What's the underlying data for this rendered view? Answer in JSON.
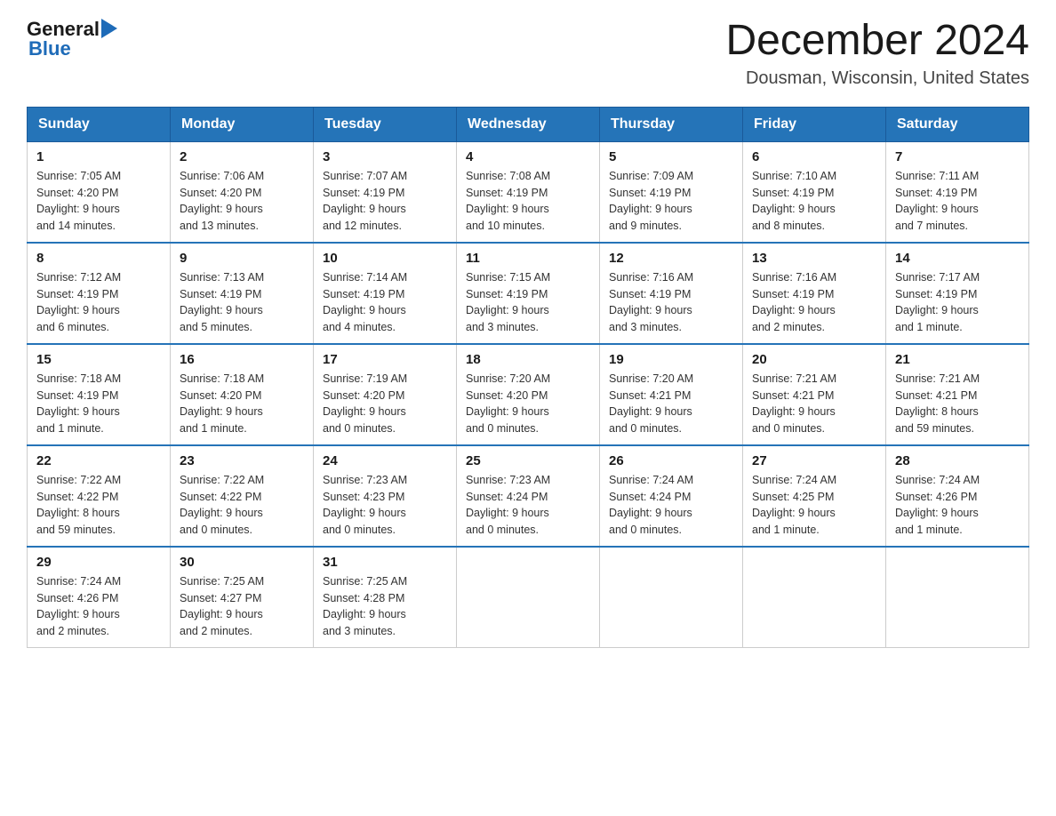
{
  "header": {
    "logo": {
      "general": "General",
      "blue": "Blue",
      "arrow": "▶"
    },
    "title": "December 2024",
    "location": "Dousman, Wisconsin, United States"
  },
  "days_of_week": [
    "Sunday",
    "Monday",
    "Tuesday",
    "Wednesday",
    "Thursday",
    "Friday",
    "Saturday"
  ],
  "weeks": [
    [
      {
        "day": "1",
        "sunrise": "7:05 AM",
        "sunset": "4:20 PM",
        "daylight": "9 hours and 14 minutes."
      },
      {
        "day": "2",
        "sunrise": "7:06 AM",
        "sunset": "4:20 PM",
        "daylight": "9 hours and 13 minutes."
      },
      {
        "day": "3",
        "sunrise": "7:07 AM",
        "sunset": "4:19 PM",
        "daylight": "9 hours and 12 minutes."
      },
      {
        "day": "4",
        "sunrise": "7:08 AM",
        "sunset": "4:19 PM",
        "daylight": "9 hours and 10 minutes."
      },
      {
        "day": "5",
        "sunrise": "7:09 AM",
        "sunset": "4:19 PM",
        "daylight": "9 hours and 9 minutes."
      },
      {
        "day": "6",
        "sunrise": "7:10 AM",
        "sunset": "4:19 PM",
        "daylight": "9 hours and 8 minutes."
      },
      {
        "day": "7",
        "sunrise": "7:11 AM",
        "sunset": "4:19 PM",
        "daylight": "9 hours and 7 minutes."
      }
    ],
    [
      {
        "day": "8",
        "sunrise": "7:12 AM",
        "sunset": "4:19 PM",
        "daylight": "9 hours and 6 minutes."
      },
      {
        "day": "9",
        "sunrise": "7:13 AM",
        "sunset": "4:19 PM",
        "daylight": "9 hours and 5 minutes."
      },
      {
        "day": "10",
        "sunrise": "7:14 AM",
        "sunset": "4:19 PM",
        "daylight": "9 hours and 4 minutes."
      },
      {
        "day": "11",
        "sunrise": "7:15 AM",
        "sunset": "4:19 PM",
        "daylight": "9 hours and 3 minutes."
      },
      {
        "day": "12",
        "sunrise": "7:16 AM",
        "sunset": "4:19 PM",
        "daylight": "9 hours and 3 minutes."
      },
      {
        "day": "13",
        "sunrise": "7:16 AM",
        "sunset": "4:19 PM",
        "daylight": "9 hours and 2 minutes."
      },
      {
        "day": "14",
        "sunrise": "7:17 AM",
        "sunset": "4:19 PM",
        "daylight": "9 hours and 1 minute."
      }
    ],
    [
      {
        "day": "15",
        "sunrise": "7:18 AM",
        "sunset": "4:19 PM",
        "daylight": "9 hours and 1 minute."
      },
      {
        "day": "16",
        "sunrise": "7:18 AM",
        "sunset": "4:20 PM",
        "daylight": "9 hours and 1 minute."
      },
      {
        "day": "17",
        "sunrise": "7:19 AM",
        "sunset": "4:20 PM",
        "daylight": "9 hours and 0 minutes."
      },
      {
        "day": "18",
        "sunrise": "7:20 AM",
        "sunset": "4:20 PM",
        "daylight": "9 hours and 0 minutes."
      },
      {
        "day": "19",
        "sunrise": "7:20 AM",
        "sunset": "4:21 PM",
        "daylight": "9 hours and 0 minutes."
      },
      {
        "day": "20",
        "sunrise": "7:21 AM",
        "sunset": "4:21 PM",
        "daylight": "9 hours and 0 minutes."
      },
      {
        "day": "21",
        "sunrise": "7:21 AM",
        "sunset": "4:21 PM",
        "daylight": "8 hours and 59 minutes."
      }
    ],
    [
      {
        "day": "22",
        "sunrise": "7:22 AM",
        "sunset": "4:22 PM",
        "daylight": "8 hours and 59 minutes."
      },
      {
        "day": "23",
        "sunrise": "7:22 AM",
        "sunset": "4:22 PM",
        "daylight": "9 hours and 0 minutes."
      },
      {
        "day": "24",
        "sunrise": "7:23 AM",
        "sunset": "4:23 PM",
        "daylight": "9 hours and 0 minutes."
      },
      {
        "day": "25",
        "sunrise": "7:23 AM",
        "sunset": "4:24 PM",
        "daylight": "9 hours and 0 minutes."
      },
      {
        "day": "26",
        "sunrise": "7:24 AM",
        "sunset": "4:24 PM",
        "daylight": "9 hours and 0 minutes."
      },
      {
        "day": "27",
        "sunrise": "7:24 AM",
        "sunset": "4:25 PM",
        "daylight": "9 hours and 1 minute."
      },
      {
        "day": "28",
        "sunrise": "7:24 AM",
        "sunset": "4:26 PM",
        "daylight": "9 hours and 1 minute."
      }
    ],
    [
      {
        "day": "29",
        "sunrise": "7:24 AM",
        "sunset": "4:26 PM",
        "daylight": "9 hours and 2 minutes."
      },
      {
        "day": "30",
        "sunrise": "7:25 AM",
        "sunset": "4:27 PM",
        "daylight": "9 hours and 2 minutes."
      },
      {
        "day": "31",
        "sunrise": "7:25 AM",
        "sunset": "4:28 PM",
        "daylight": "9 hours and 3 minutes."
      },
      null,
      null,
      null,
      null
    ]
  ],
  "labels": {
    "sunrise": "Sunrise:",
    "sunset": "Sunset:",
    "daylight": "Daylight:"
  }
}
